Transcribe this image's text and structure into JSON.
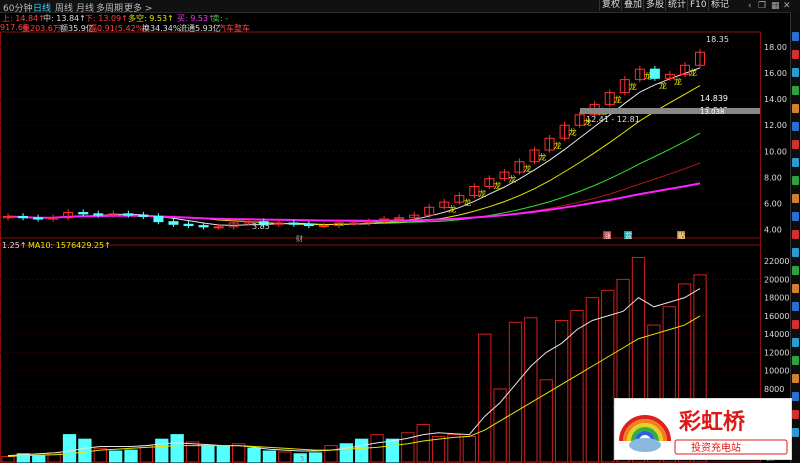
{
  "tabs": {
    "items": [
      "60分钟",
      "日线",
      "周线",
      "月线",
      "多周期",
      "更多 >"
    ],
    "active_index": 1
  },
  "toolbar": {
    "buttons": [
      "复权",
      "叠加",
      "多股",
      "统计",
      "F10",
      "标记"
    ]
  },
  "info_row1": {
    "high": "上: 14.84↑",
    "mid": "中: 13.84↑",
    "low": "下: 13.09↑",
    "duo": "多空: 9.53↑",
    "mai": "买: 9.53↑",
    "sell": "卖: -"
  },
  "info_row2": {
    "price": "917.66",
    "vol": "量203.6万",
    "amt": "额35.9亿",
    "chg": "幅0.91(5.42%)",
    "turn": "换34.34%",
    "float": "流通5.93亿",
    "sector": "汽车整车"
  },
  "price_labels": {
    "high": "18.35",
    "ma1": "14.839",
    "ma2": "13.843",
    "ma3": "13.038",
    "range": "12.41 - 12.81",
    "low": "3.85",
    "sig": "龙",
    "sig_multi": "龙龙龙龙"
  },
  "price_axis": [
    "18.00",
    "16.00",
    "14.00",
    "12.00",
    "10.00",
    "8.00",
    "6.00",
    "4.00"
  ],
  "markers": {
    "cai": "财",
    "zhang": "涨",
    "pen": "盆",
    "tie": "贴"
  },
  "volume_header": {
    "v": "1.25↑",
    "ma10": "MA10: 1576429.25↑"
  },
  "volume_axis": [
    "22000",
    "20000",
    "18000",
    "16000",
    "14000",
    "12000",
    "10000",
    "8000",
    "6000"
  ],
  "bottom_labels": {
    "mid": "5",
    "right": "Lu"
  },
  "watermark": {
    "title": "彩虹桥",
    "subtitle": "投资充电站"
  },
  "colors": {
    "up": "#ff3030",
    "down": "#54ffff",
    "ma_white": "#e6e6e6",
    "ma_yellow": "#e6e600",
    "ma_green": "#30e030",
    "ma_magenta": "#ff20ff",
    "ma_darkred": "#b01818",
    "accent": "#29d8ff"
  },
  "chart_data": [
    {
      "type": "candlestick",
      "title": "",
      "x": [
        1,
        2,
        3,
        4,
        5,
        6,
        7,
        8,
        9,
        10,
        11,
        12,
        13,
        14,
        15,
        16,
        17,
        18,
        19,
        20,
        21,
        22,
        23,
        24,
        25,
        26,
        27,
        28,
        29,
        30,
        31,
        32,
        33,
        34,
        35,
        36,
        37,
        38,
        39,
        40,
        41,
        42,
        43,
        44,
        45,
        46,
        47
      ],
      "open": [
        4.9,
        5.0,
        4.9,
        4.8,
        4.9,
        5.3,
        5.2,
        5.1,
        5.2,
        5.1,
        5.0,
        4.6,
        4.4,
        4.3,
        4.2,
        4.2,
        4.5,
        4.6,
        4.4,
        4.5,
        4.4,
        4.3,
        4.3,
        4.5,
        4.5,
        4.6,
        4.8,
        4.9,
        5.1,
        5.7,
        6.1,
        6.6,
        7.3,
        7.9,
        8.4,
        9.2,
        10.1,
        11.0,
        12.0,
        12.8,
        13.6,
        14.5,
        15.5,
        16.3,
        15.6,
        15.9,
        16.6
      ],
      "close": [
        5.0,
        4.9,
        4.8,
        4.9,
        5.3,
        5.2,
        5.1,
        5.2,
        5.1,
        5.0,
        4.6,
        4.4,
        4.3,
        4.2,
        4.2,
        4.5,
        4.6,
        4.4,
        4.5,
        4.4,
        4.3,
        4.3,
        4.5,
        4.5,
        4.6,
        4.8,
        4.9,
        5.1,
        5.7,
        6.1,
        6.6,
        7.3,
        7.9,
        8.4,
        9.2,
        10.1,
        11.0,
        12.0,
        12.8,
        13.6,
        14.5,
        15.5,
        16.3,
        15.6,
        15.9,
        16.6,
        17.6
      ],
      "ylim": [
        3.5,
        19
      ]
    },
    {
      "type": "bar",
      "title": "",
      "series": [
        {
          "name": "MA10",
          "values": []
        }
      ],
      "values": [
        600,
        900,
        700,
        1000,
        3000,
        2500,
        1500,
        1200,
        1300,
        1800,
        2500,
        3000,
        2200,
        1800,
        1700,
        2000,
        1500,
        1200,
        1100,
        900,
        1000,
        1800,
        2000,
        2500,
        3000,
        2500,
        3200,
        4100,
        2800,
        3000,
        2800,
        14000,
        8000,
        15300,
        15800,
        9000,
        15500,
        16600,
        18000,
        18800,
        20000,
        22400,
        15000,
        17000,
        19500,
        20500
      ],
      "ma5": [
        700,
        800,
        900,
        1000,
        1200,
        1500,
        1700,
        1700,
        1700,
        1800,
        2000,
        2100,
        2000,
        1900,
        1800,
        1800,
        1600,
        1400,
        1300,
        1200,
        1200,
        1300,
        1500,
        1800,
        2100,
        2300,
        2600,
        3000,
        3200,
        3100,
        3000,
        5000,
        6500,
        8500,
        10500,
        12000,
        13000,
        14500,
        15500,
        16000,
        16500,
        18000,
        17000,
        17500,
        18000,
        19000
      ],
      "ma10": [
        600,
        700,
        750,
        800,
        900,
        1100,
        1300,
        1400,
        1500,
        1600,
        1700,
        1800,
        1800,
        1800,
        1800,
        1800,
        1700,
        1600,
        1500,
        1400,
        1300,
        1300,
        1400,
        1500,
        1600,
        1800,
        2000,
        2300,
        2500,
        2700,
        2800,
        3500,
        4500,
        5500,
        6500,
        7500,
        8500,
        9500,
        10500,
        11500,
        12500,
        13500,
        14000,
        14500,
        15000,
        16000
      ],
      "ylim": [
        0,
        23000
      ]
    }
  ]
}
